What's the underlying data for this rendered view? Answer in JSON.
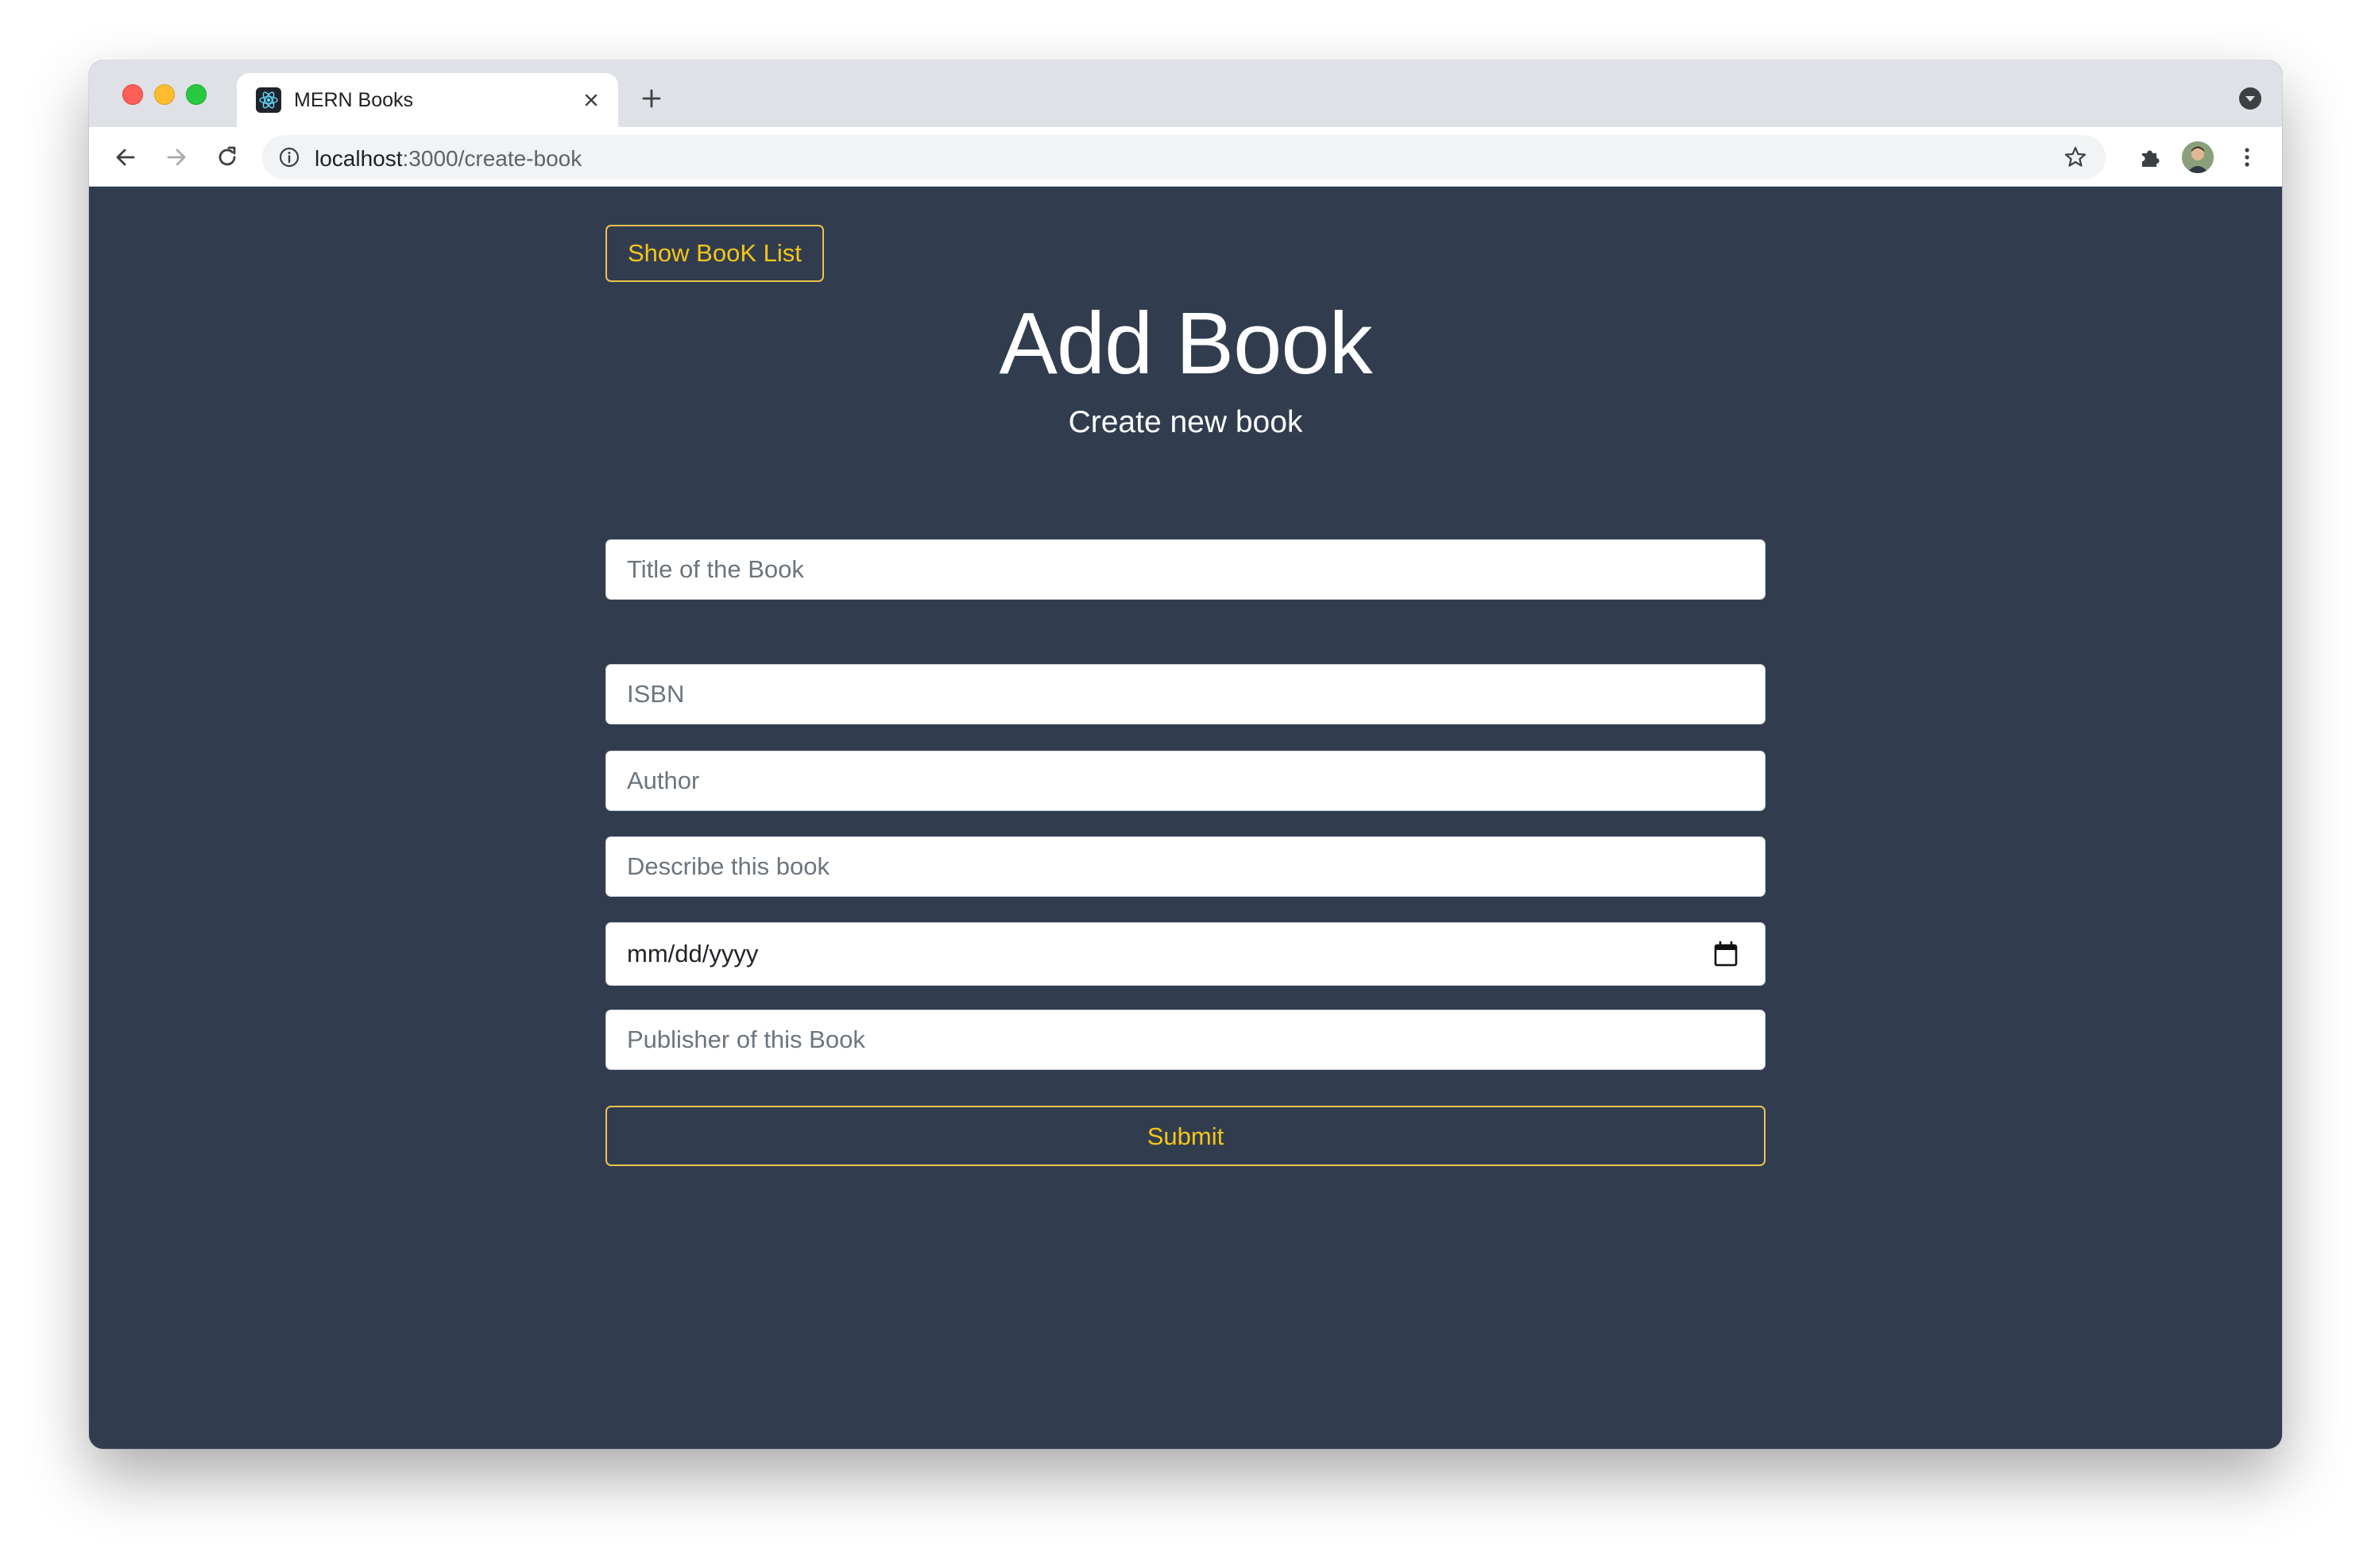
{
  "browser": {
    "tab": {
      "title": "MERN Books",
      "favicon": "react-logo-icon"
    },
    "address_bar": {
      "host": "localhost",
      "path": ":3000/create-book"
    },
    "icons": {
      "back": "arrow-left-icon",
      "forward": "arrow-right-icon",
      "reload": "reload-icon",
      "site_info": "info-icon",
      "bookmark": "star-icon",
      "extensions": "puzzle-icon",
      "menu": "kebab-menu-icon",
      "new_tab": "plus-icon",
      "tab_close": "close-icon",
      "tab_search": "chevron-down-circle-icon"
    }
  },
  "page": {
    "show_list_button": "Show BooK List",
    "title": "Add Book",
    "subtitle": "Create new book",
    "form": {
      "title_placeholder": "Title of the Book",
      "isbn_placeholder": "ISBN",
      "author_placeholder": "Author",
      "description_placeholder": "Describe this book",
      "published_date_value": "mm/dd/yyyy",
      "publisher_placeholder": "Publisher of this Book",
      "submit_label": "Submit"
    }
  },
  "colors": {
    "page_background": "#313d4f",
    "accent": "#f5c518",
    "tab_strip": "#dee1e6",
    "omnibox": "#f1f3f4"
  }
}
